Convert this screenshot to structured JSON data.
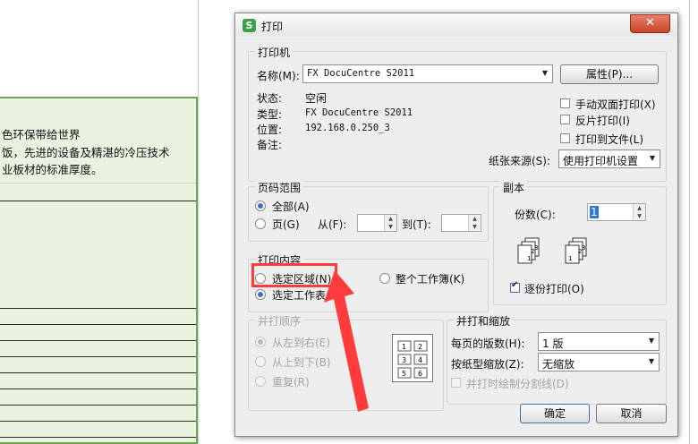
{
  "spreadsheet": {
    "text_lines": [
      "色环保带给世界",
      "饭，先进的设备及精湛的冷压技术",
      "业板材的标准厚度。"
    ]
  },
  "dialog": {
    "title": "打印",
    "app_icon": "S",
    "close_symbol": "✕",
    "printer": {
      "group_title": "打印机",
      "name_label": "名称(M):",
      "name_value": "FX DocuCentre S2011",
      "properties_button": "属性(P)...",
      "status_label": "状态:",
      "status_value": "空闲",
      "type_label": "类型:",
      "type_value": "FX DocuCentre S2011",
      "location_label": "位置:",
      "location_value": "192.168.0.250_3",
      "comment_label": "备注:",
      "manual_duplex": "手动双面打印(X)",
      "reverse_print": "反片打印(I)",
      "print_to_file": "打印到文件(L)",
      "paper_source_label": "纸张来源(S):",
      "paper_source_value": "使用打印机设置"
    },
    "page_range": {
      "group_title": "页码范围",
      "all": "全部(A)",
      "pages": "页(G)",
      "from_label": "从(F):",
      "to_label": "到(T):"
    },
    "copies": {
      "group_title": "副本",
      "count_label": "份数(C):",
      "count_value": "1",
      "collate": "逐份打印(O)",
      "collate_icon_a": [
        "1",
        "2",
        "3"
      ],
      "collate_icon_b": [
        "1",
        "2",
        "3"
      ]
    },
    "print_content": {
      "group_title": "打印内容",
      "selection": "选定区域(N)",
      "entire_workbook": "整个工作簿(K)",
      "active_sheet": "选定工作表(V)"
    },
    "print_order": {
      "group_title": "并打顺序",
      "left_to_right": "从左到右(E)",
      "top_to_bottom": "从上到下(B)",
      "repeat": "重复(R)",
      "grid_numbers": [
        "1",
        "2",
        "3",
        "4",
        "5",
        "6"
      ]
    },
    "zoom": {
      "group_title": "并打和缩放",
      "pages_per_sheet_label": "每页的版数(H):",
      "pages_per_sheet_value": "1 版",
      "scale_label": "按纸型缩放(Z):",
      "scale_value": "无缩放",
      "draw_borders": "并打时绘制分割线(D)"
    },
    "ok_button": "确定",
    "cancel_button": "取消"
  },
  "colors": {
    "highlight_red": "#ff3b3b",
    "selection_green": "#e9f3df",
    "close_red": "#c9442a"
  }
}
